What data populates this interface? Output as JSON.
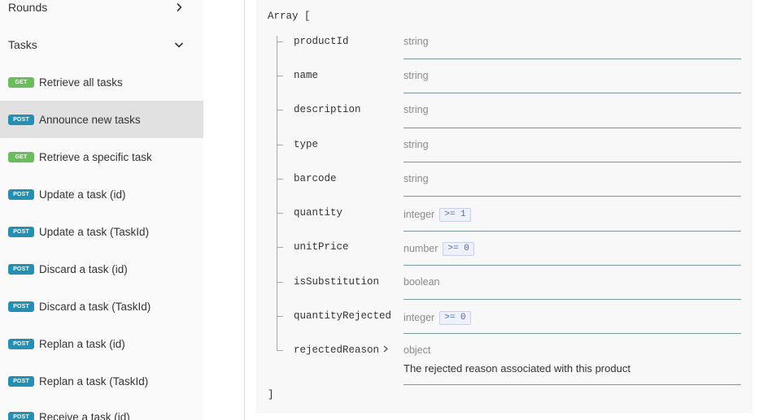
{
  "sidebar": {
    "sections": {
      "rounds": "Rounds",
      "tasks": "Tasks"
    },
    "items": [
      {
        "method": "GET",
        "label": "Retrieve all tasks"
      },
      {
        "method": "POST",
        "label": "Announce new tasks"
      },
      {
        "method": "GET",
        "label": "Retrieve a specific task"
      },
      {
        "method": "POST",
        "label": "Update a task (id)"
      },
      {
        "method": "POST",
        "label": "Update a task (TaskId)"
      },
      {
        "method": "POST",
        "label": "Discard a task (id)"
      },
      {
        "method": "POST",
        "label": "Discard a task (TaskId)"
      },
      {
        "method": "POST",
        "label": "Replan a task (id)"
      },
      {
        "method": "POST",
        "label": "Replan a task (TaskId)"
      },
      {
        "method": "POST",
        "label": "Receive a task (id)"
      }
    ],
    "active_item": "Announce new tasks"
  },
  "schema": {
    "open": "Array [",
    "close": "]",
    "fields": [
      {
        "name": "productId",
        "type": "string"
      },
      {
        "name": "name",
        "type": "string"
      },
      {
        "name": "description",
        "type": "string"
      },
      {
        "name": "type",
        "type": "string"
      },
      {
        "name": "barcode",
        "type": "string"
      },
      {
        "name": "quantity",
        "type": "integer",
        "constraint": ">= 1"
      },
      {
        "name": "unitPrice",
        "type": "number",
        "constraint": ">= 0"
      },
      {
        "name": "isSubstitution",
        "type": "boolean"
      },
      {
        "name": "quantityRejected",
        "type": "integer",
        "constraint": ">= 0"
      },
      {
        "name": "rejectedReason",
        "type": "object",
        "expandable": true,
        "description": "The rejected reason associated with this product"
      }
    ]
  },
  "colors": {
    "get_badge": "#6bbd5b",
    "post_badge": "#248fb2",
    "active_bg": "#e1e1e1"
  },
  "icons": {
    "rounds_toggle": "chevron-right-icon",
    "tasks_toggle": "chevron-down-icon",
    "expand_field": "chevron-right-icon"
  }
}
